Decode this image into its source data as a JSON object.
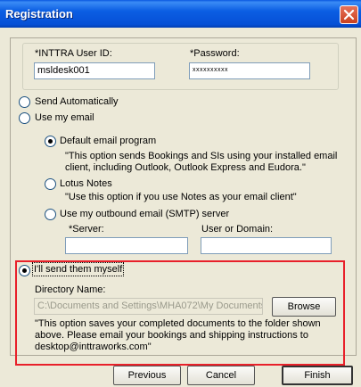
{
  "window": {
    "title": "Registration",
    "close_icon": "close-icon"
  },
  "credentials": {
    "user_id_label": "*INTTRA User ID:",
    "user_id_value": "msldesk001",
    "password_label": "*Password:",
    "password_value": "xxxxxxxxxx"
  },
  "options": {
    "send_automatically": "Send Automatically",
    "use_my_email": "Use my email",
    "default_program": "Default email program",
    "default_program_desc_1": "\"This option sends Bookings and SIs using your installed email",
    "default_program_desc_2": "client, including Outlook, Outlook Express and Eudora.\"",
    "lotus_notes": "Lotus Notes",
    "lotus_notes_desc": "\"Use this option if you use Notes as your email client\"",
    "smtp": "Use my outbound email (SMTP) server",
    "server_label": "*Server:",
    "server_value": "",
    "user_domain_label": "User or Domain:",
    "user_domain_value": "",
    "send_myself": "I'll send them myself",
    "directory_label": "Directory Name:",
    "directory_value": "C:\\Documents and Settings\\MHA072\\My Documents",
    "browse": "Browse",
    "send_myself_desc_1": "\"This option saves your completed documents to the folder shown",
    "send_myself_desc_2": "above.  Please email your bookings and shipping instructions to",
    "send_myself_desc_3": "desktop@inttraworks.com\""
  },
  "footer": {
    "previous": "Previous",
    "cancel": "Cancel",
    "finish": "Finish"
  },
  "colors": {
    "title_bar": "#0b5ee3",
    "highlight": "#e8202a"
  }
}
